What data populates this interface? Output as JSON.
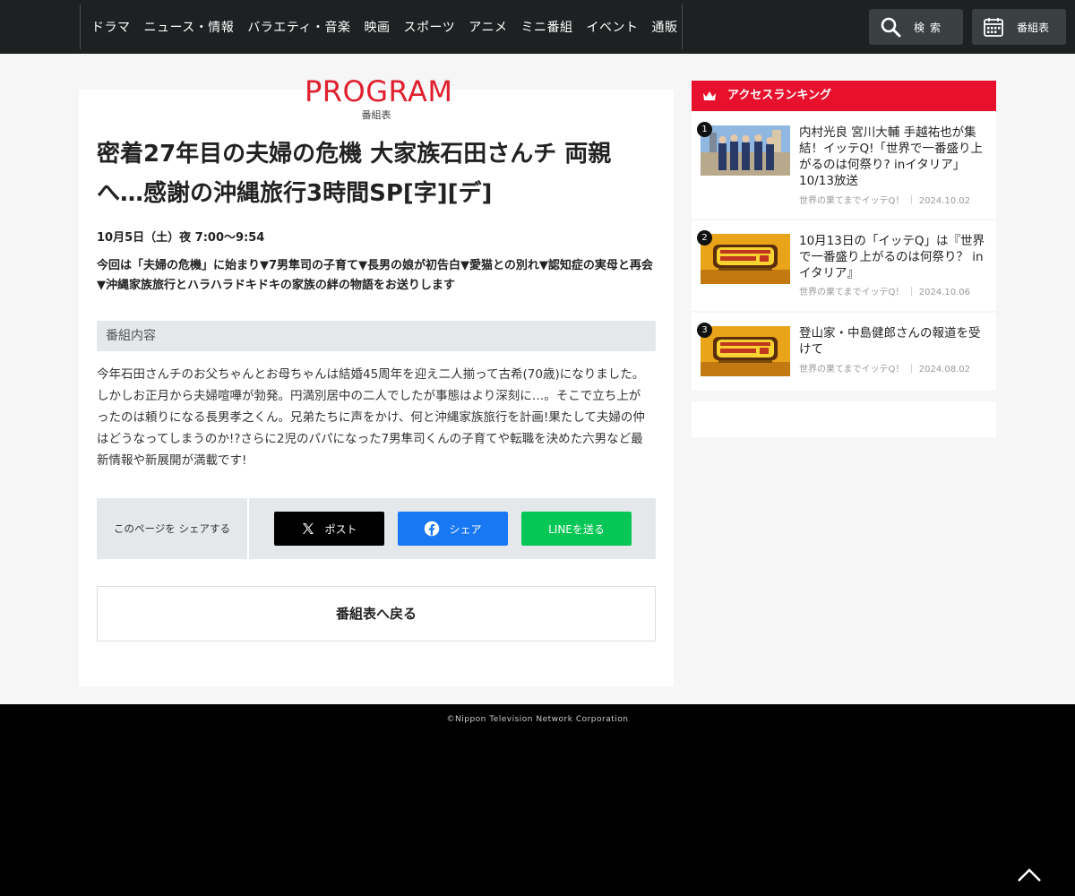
{
  "nav": {
    "items": [
      "ドラマ",
      "ニュース・情報",
      "バラエティ・音楽",
      "映画",
      "スポーツ",
      "アニメ",
      "ミニ番組",
      "イベント",
      "通販"
    ],
    "search_label": "検索",
    "program_label": "番組表"
  },
  "program": {
    "heading": "PROGRAM",
    "subheading": "番組表",
    "title": "密着27年目の夫婦の危機 大家族石田さんチ 両親へ…感謝の沖縄旅行3時間SP[字][デ]",
    "air_time": "10月5日（土）夜 7:00〜9:54",
    "summary": "今回は「夫婦の危機」に始まり▼7男隼司の子育て▼長男の娘が初告白▼愛猫との別れ▼認知症の実母と再会▼沖縄家族旅行とハラハラドキドキの家族の絆の物語をお送りします",
    "section_label": "番組内容",
    "body": "今年石田さんチのお父ちゃんとお母ちゃんは結婚45周年を迎え二人揃って古希(70歳)になりました。しかしお正月から夫婦喧嘩が勃発。円満別居中の二人でしたが事態はより深刻に…。そこで立ち上がったのは頼りになる長男孝之くん。兄弟たちに声をかけ、何と沖縄家族旅行を計画!果たして夫婦の仲はどうなってしまうのか!?さらに2児のパパになった7男隼司くんの子育てや転職を決めた六男など最新情報や新展開が満載です!"
  },
  "share": {
    "label": "このページを シェアする",
    "x_label": "ポスト",
    "fb_label": "シェア",
    "line_label": "LINEを送る"
  },
  "back_label": "番組表へ戻る",
  "ranking": {
    "header": "アクセスランキング",
    "items": [
      {
        "rank": "1",
        "title": "内村光良 宮川大輔 手越祐也が集結！イッテQ!「世界で一番盛り上がるのは何祭り? inイタリア」10/13放送",
        "show": "世界の果てまでイッテQ！",
        "date": "2024.10.02"
      },
      {
        "rank": "2",
        "title": "10月13日の「イッテQ」は『世界で一番盛り上がるのは何祭り？ in イタリア』",
        "show": "世界の果てまでイッテQ！",
        "date": "2024.10.06"
      },
      {
        "rank": "3",
        "title": "登山家・中島健郎さんの報道を受けて",
        "show": "世界の果てまでイッテQ！",
        "date": "2024.08.02"
      }
    ]
  },
  "footer": {
    "copyright": "©Nippon Television Network Corporation"
  },
  "colors": {
    "accent": "#e8112d",
    "program_heading": "#e0202e",
    "header_bg": "#1d2122",
    "x": "#000000",
    "facebook": "#1877f2",
    "line": "#06c755"
  }
}
